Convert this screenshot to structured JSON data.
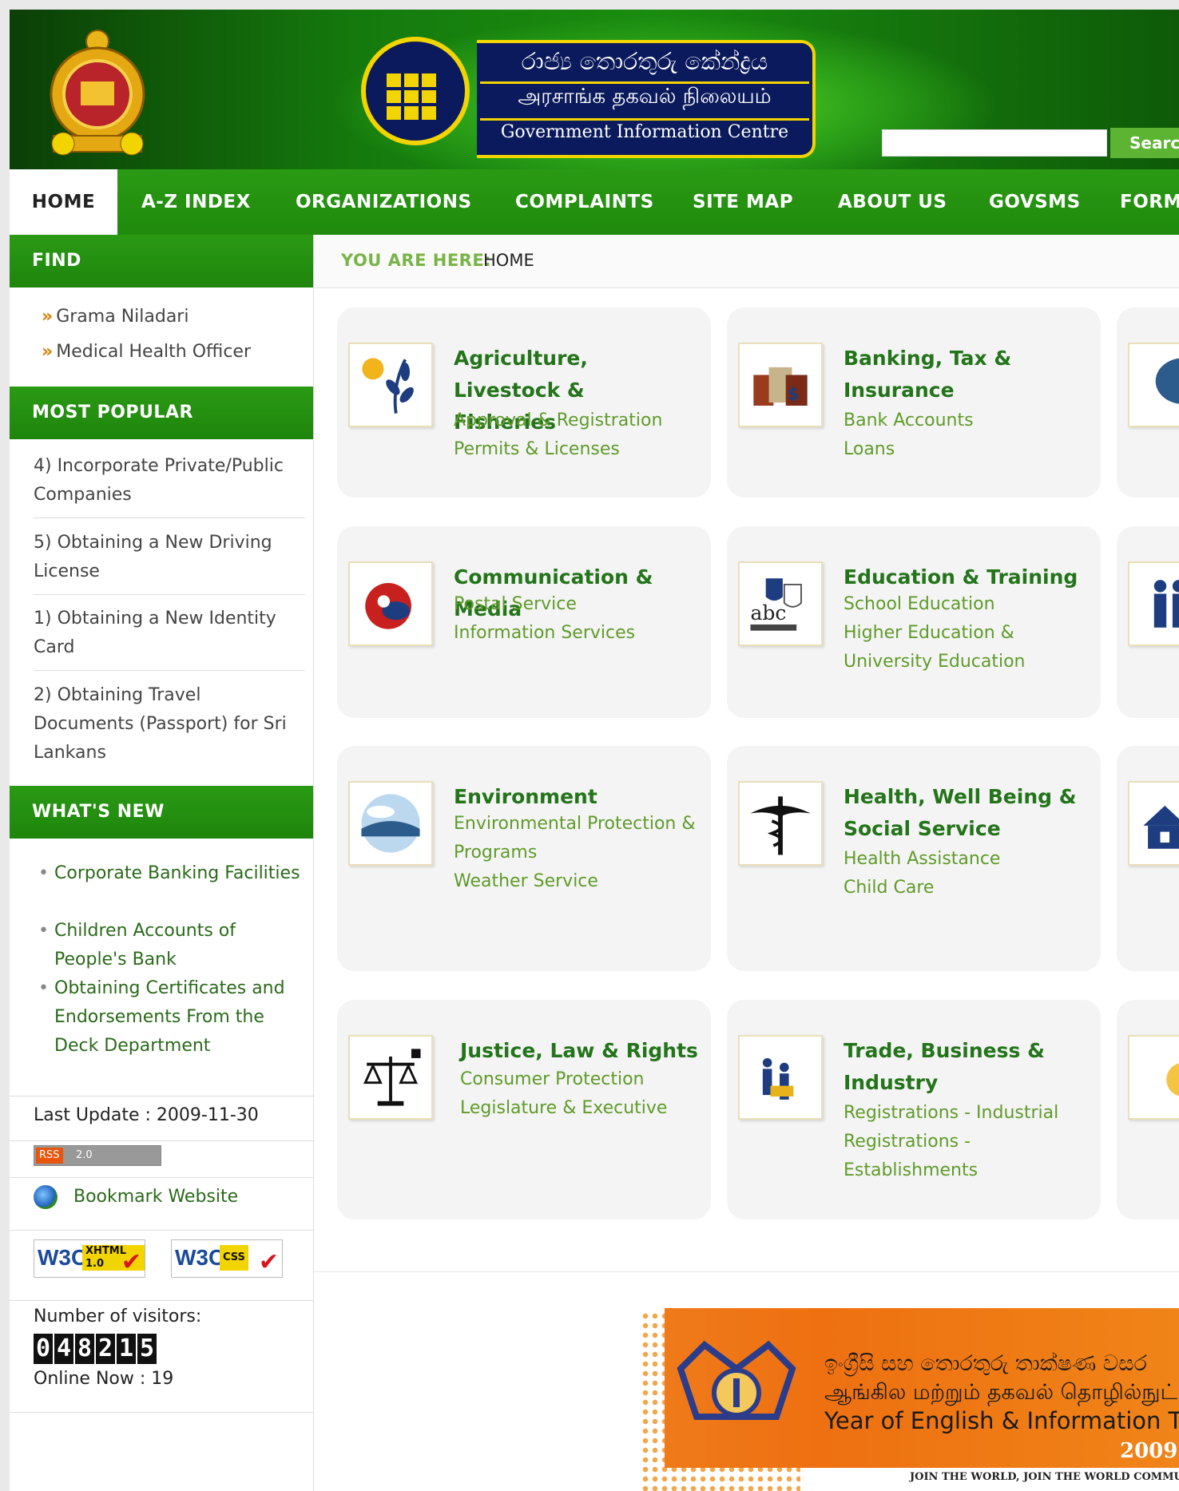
{
  "header": {
    "logo_sinhala": "රාජ්‍ය තොරතුරු කේන්ද්‍රය",
    "logo_tamil": "அரசாங்க தகவல் நிலையம்",
    "logo_english": "Government Information Centre",
    "search_placeholder": "",
    "search_button": "Search"
  },
  "nav": [
    {
      "label": "HOME",
      "active": true
    },
    {
      "label": "A-Z INDEX"
    },
    {
      "label": "ORGANIZATIONS"
    },
    {
      "label": "COMPLAINTS"
    },
    {
      "label": "SITE MAP"
    },
    {
      "label": "ABOUT US"
    },
    {
      "label": "GOVSMS"
    },
    {
      "label": "FORMS"
    }
  ],
  "sidebar": {
    "find_title": "FIND",
    "find_links": [
      "Grama Niladari",
      "Medical Health Officer"
    ],
    "popular_title": "MOST POPULAR",
    "popular": [
      "4) Incorporate Private/Public Companies",
      "5) Obtaining a New Driving License",
      "1) Obtaining a New Identity Card",
      "2) Obtaining Travel Documents (Passport) for Sri Lankans"
    ],
    "new_title": "WHAT'S NEW",
    "new_items": [
      "Corporate Banking Facilities",
      "Children Accounts of People's Bank",
      "Obtaining Certificates and Endorsements From the Deck Department"
    ],
    "last_update": "Last Update : 2009-11-30",
    "rss_label": "RSS",
    "rss_version": "2.0",
    "bookmark": "Bookmark Website",
    "w3c_xhtml": "XHTML 1.0",
    "w3c_css": "CSS",
    "visitors_label": "Number of visitors:",
    "visitor_digits": [
      "0",
      "4",
      "8",
      "2",
      "1",
      "5"
    ],
    "online_now": "Online Now : 19"
  },
  "breadcrumb": {
    "label": "YOU ARE HERE:",
    "value": "HOME"
  },
  "cards": [
    {
      "title": "Agriculture, Livestock & Fisheries",
      "subs": [
        "Approval & Registration",
        "Permits & Licenses"
      ],
      "icon": "plant-icon"
    },
    {
      "title": "Banking, Tax & Insurance",
      "subs": [
        "Bank Accounts",
        "Loans"
      ],
      "icon": "money-icon"
    },
    {
      "title": "Communication & Media",
      "subs": [
        "Postal Service",
        "Information Services"
      ],
      "icon": "communication-icon"
    },
    {
      "title": "Education & Training",
      "subs": [
        "School Education",
        "Higher Education & University Education"
      ],
      "icon": "education-icon"
    },
    {
      "title": "Environment",
      "subs": [
        "Environmental Protection & Programs",
        "Weather Service"
      ],
      "icon": "environment-icon"
    },
    {
      "title": "Health, Well Being & Social Service",
      "subs": [
        "Health Assistance",
        "Child Care"
      ],
      "icon": "caduceus-icon"
    },
    {
      "title": "Justice, Law & Rights",
      "subs": [
        "Consumer Protection",
        "Legislature & Executive"
      ],
      "icon": "scales-icon"
    },
    {
      "title": "Trade, Business & Industry",
      "subs": [
        "Registrations - Industrial Registrations - Establishments"
      ],
      "icon": "business-people-icon"
    }
  ],
  "banner": {
    "line_sinhala": "ඉංග්‍රීසි සහ තොරතුරු තාක්ෂණ වසර",
    "line_tamil": "ஆங்கில மற்றும் தகவல் தொழில்நுட்ப வருடம்",
    "line_english": "Year of English & Information Technology",
    "year": "2009",
    "tagline": "JOIN THE WORLD, JOIN THE WORLD COMMUNITY"
  },
  "colors": {
    "brand_green": "#2a9a14",
    "title_green": "#23741a",
    "sub_green": "#5f9b2a",
    "banner_orange": "#ef7a1a"
  }
}
